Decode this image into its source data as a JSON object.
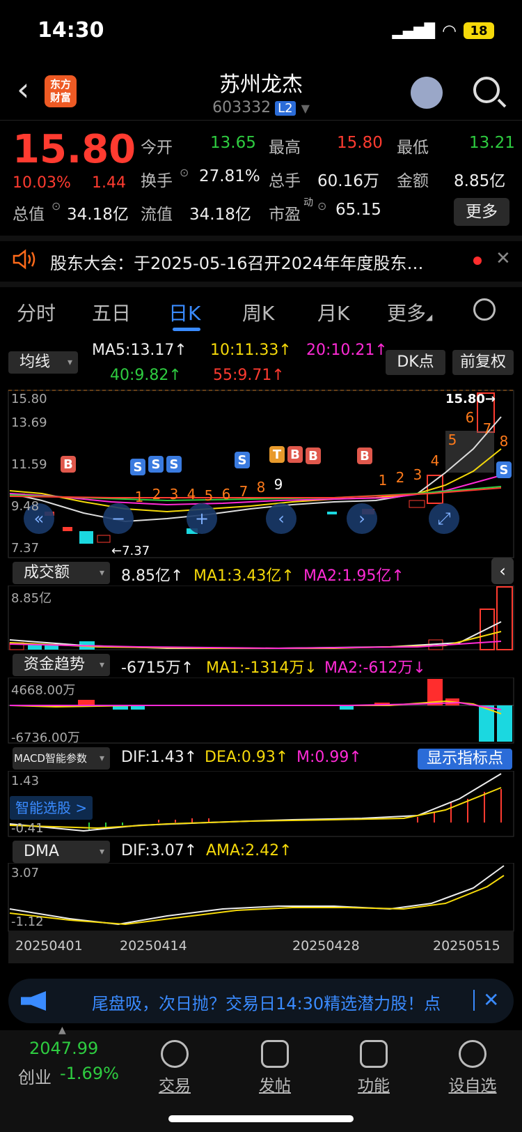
{
  "status": {
    "time": "14:30",
    "battery": "18"
  },
  "header": {
    "logo": "东方\n财富",
    "name": "苏州龙杰",
    "code": "603332",
    "badge": "L2"
  },
  "quote": {
    "price": "15.80",
    "pct": "10.03%",
    "change": "1.44",
    "fields": [
      {
        "label": "今开",
        "value": "13.65",
        "color": "green"
      },
      {
        "label": "最高",
        "value": "15.80",
        "color": "red"
      },
      {
        "label": "最低",
        "value": "13.21",
        "color": "green"
      },
      {
        "label": "换手",
        "value": "27.81%",
        "color": "white"
      },
      {
        "label": "总手",
        "value": "60.16万",
        "color": "white"
      },
      {
        "label": "金额",
        "value": "8.85亿",
        "color": "white"
      },
      {
        "label": "总值",
        "value": "34.18亿",
        "color": "white"
      },
      {
        "label": "流值",
        "value": "34.18亿",
        "color": "white"
      },
      {
        "label": "市盈",
        "value": "65.15",
        "color": "white"
      }
    ],
    "pe_sup": "动",
    "more": "更多"
  },
  "notice": {
    "text": "股东大会：于2025-05-16召开2024年年度股东…"
  },
  "tabs": [
    "分时",
    "五日",
    "日K",
    "周K",
    "月K",
    "更多"
  ],
  "ma": {
    "dropdown": "均线",
    "ma5": "MA5:13.17↑",
    "ma10": "10:11.33↑",
    "ma20": "20:10.21↑",
    "ma40": "40:9.82↑",
    "ma55": "55:9.71↑",
    "dk": "DK点",
    "fq": "前复权"
  },
  "kline_axis": {
    "top": "15.80",
    "y2": "13.69",
    "y3": "11.59",
    "y4": "9.48",
    "low": "7.37",
    "high_label": "15.80→",
    "low_label": "←7.37"
  },
  "volume": {
    "dropdown": "成交额",
    "v": "8.85亿↑",
    "ma1": "MA1:3.43亿↑",
    "ma2": "MA2:1.95亿↑",
    "axis": "8.85亿"
  },
  "fund": {
    "dropdown": "资金趋势",
    "v": "-6715万↑",
    "ma1": "MA1:-1314万↓",
    "ma2": "MA2:-612万↓",
    "axis_top": "4668.00万",
    "axis_bottom": "-6736.00万"
  },
  "macd": {
    "dropdown": "MACD智能参数",
    "dif": "DIF:1.43↑",
    "dea": "DEA:0.93↑",
    "m": "M:0.99↑",
    "btn": "显示指标点",
    "axis_top": "1.43",
    "axis_bottom": "-0.41",
    "smart": "智能选股 >"
  },
  "dma": {
    "dropdown": "DMA",
    "dif": "DIF:3.07↑",
    "ama": "AMA:2.42↑",
    "axis_top": "3.07",
    "axis_bottom": "-1.12"
  },
  "dates": [
    "20250401",
    "20250414",
    "20250428",
    "20250515"
  ],
  "banner": {
    "text": "尾盘吸，次日抛？交易日14:30精选潜力股！点"
  },
  "bottom": {
    "index_value": "2047.99",
    "index_name": "创业",
    "index_pct": "-1.69%",
    "nav": [
      "交易",
      "发帖",
      "功能",
      "设自选"
    ]
  }
}
